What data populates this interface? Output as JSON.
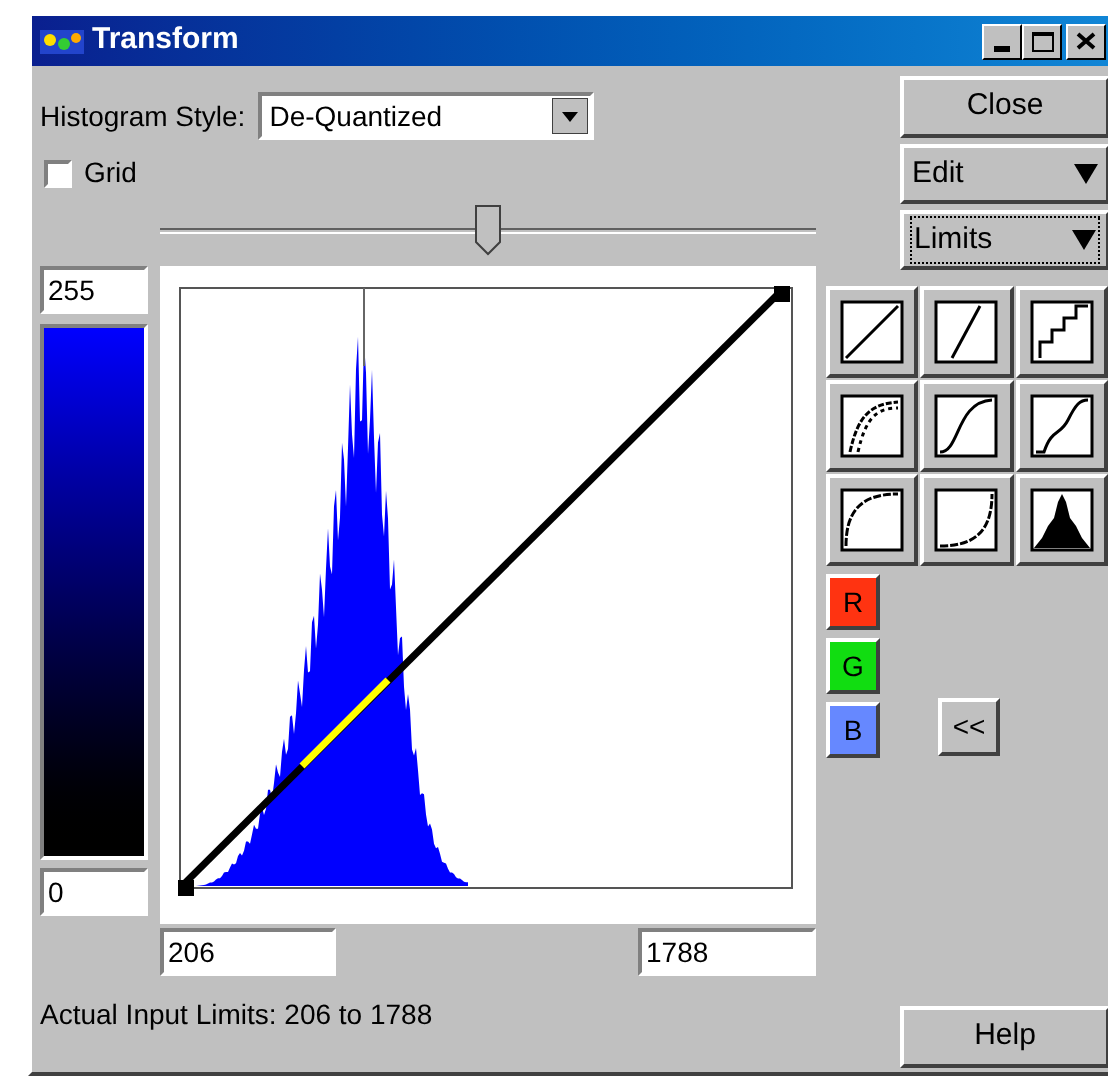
{
  "window": {
    "title": "Transform"
  },
  "histogram_style": {
    "label": "Histogram Style:",
    "value": "De-Quantized"
  },
  "grid": {
    "label": "Grid",
    "checked": false
  },
  "slider": {
    "level": 0.5
  },
  "side_buttons": [
    {
      "label": "Close",
      "kind": "plain"
    },
    {
      "label": "Edit",
      "kind": "menu",
      "focused": false
    },
    {
      "label": "Limits",
      "kind": "menu",
      "focused": true
    }
  ],
  "output_max": "255",
  "output_min": "0",
  "input_min": "206",
  "input_max": "1788",
  "presets": [
    {
      "kind": "linear"
    },
    {
      "kind": "steep"
    },
    {
      "kind": "steps"
    },
    {
      "kind": "curves"
    },
    {
      "kind": "s_curve"
    },
    {
      "kind": "wave"
    },
    {
      "kind": "log"
    },
    {
      "kind": "exp"
    },
    {
      "kind": "histogram"
    }
  ],
  "channels": [
    {
      "label": "R",
      "color": "#ff3311"
    },
    {
      "label": "G",
      "color": "#11dd11"
    },
    {
      "label": "B",
      "color": "#6688ff"
    }
  ],
  "collapse_button": "<<",
  "status": "Actual Input Limits: 206 to 1788",
  "help": "Help"
}
